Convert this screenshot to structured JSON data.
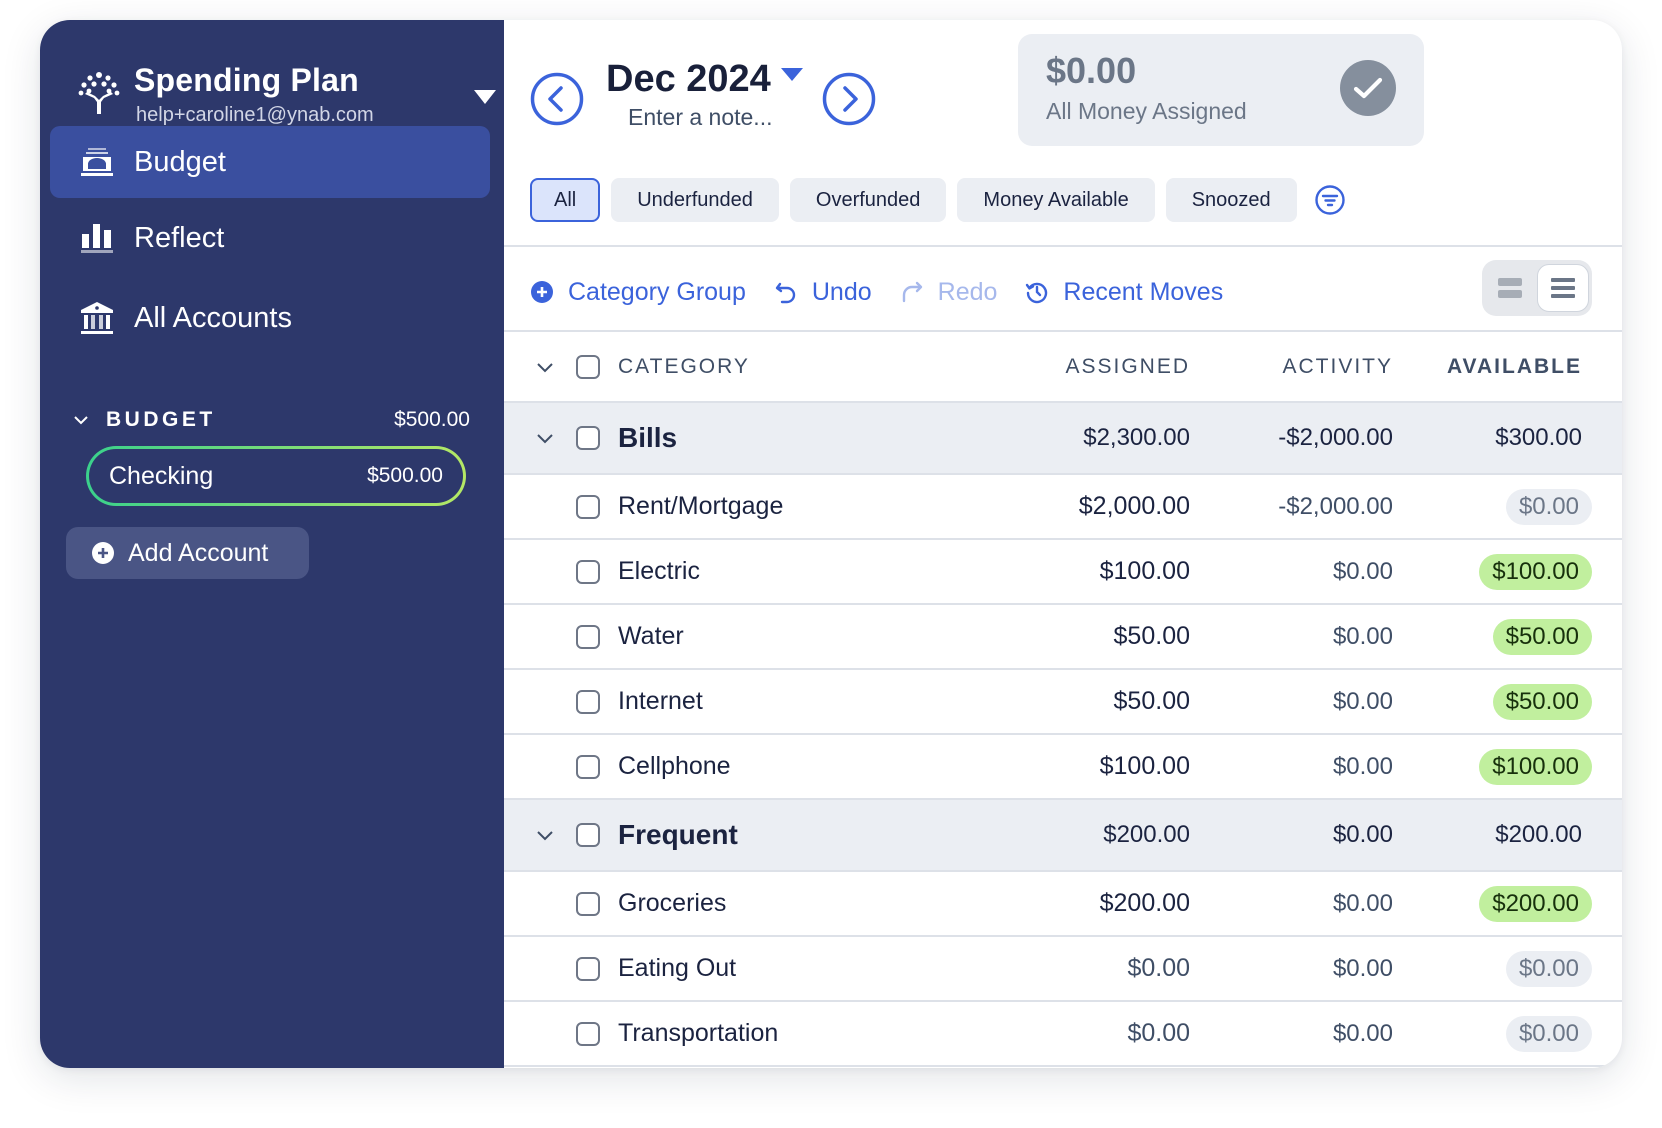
{
  "sidebar": {
    "plan_name": "Spending Plan",
    "email": "help+caroline1@ynab.com",
    "nav": [
      {
        "label": "Budget",
        "icon": "budget-icon",
        "active": true
      },
      {
        "label": "Reflect",
        "icon": "bar-chart-icon",
        "active": false
      },
      {
        "label": "All Accounts",
        "icon": "bank-icon",
        "active": false
      }
    ],
    "account_group": {
      "label": "BUDGET",
      "amount": "$500.00"
    },
    "accounts": [
      {
        "name": "Checking",
        "amount": "$500.00"
      }
    ],
    "add_account_label": "Add Account"
  },
  "header": {
    "month": "Dec 2024",
    "note_placeholder": "Enter a note...",
    "ready_to_assign": {
      "amount": "$0.00",
      "label": "All Money Assigned"
    }
  },
  "filters": [
    {
      "label": "All",
      "active": true
    },
    {
      "label": "Underfunded",
      "active": false
    },
    {
      "label": "Overfunded",
      "active": false
    },
    {
      "label": "Money Available",
      "active": false
    },
    {
      "label": "Snoozed",
      "active": false
    }
  ],
  "toolbar": {
    "category_group": "Category Group",
    "undo": "Undo",
    "redo": "Redo",
    "recent_moves": "Recent Moves"
  },
  "table": {
    "headers": {
      "category": "CATEGORY",
      "assigned": "ASSIGNED",
      "activity": "ACTIVITY",
      "available": "AVAILABLE"
    },
    "groups": [
      {
        "name": "Bills",
        "assigned": "$2,300.00",
        "activity": "-$2,000.00",
        "available": "$300.00",
        "categories": [
          {
            "name": "Rent/Mortgage",
            "assigned": "$2,000.00",
            "activity": "-$2,000.00",
            "available": "$0.00",
            "status": "zero"
          },
          {
            "name": "Electric",
            "assigned": "$100.00",
            "activity": "$0.00",
            "available": "$100.00",
            "status": "funded"
          },
          {
            "name": "Water",
            "assigned": "$50.00",
            "activity": "$0.00",
            "available": "$50.00",
            "status": "funded"
          },
          {
            "name": "Internet",
            "assigned": "$50.00",
            "activity": "$0.00",
            "available": "$50.00",
            "status": "funded"
          },
          {
            "name": "Cellphone",
            "assigned": "$100.00",
            "activity": "$0.00",
            "available": "$100.00",
            "status": "funded"
          }
        ]
      },
      {
        "name": "Frequent",
        "assigned": "$200.00",
        "activity": "$0.00",
        "available": "$200.00",
        "categories": [
          {
            "name": "Groceries",
            "assigned": "$200.00",
            "activity": "$0.00",
            "available": "$200.00",
            "status": "funded"
          },
          {
            "name": "Eating Out",
            "assigned": "$0.00",
            "activity": "$0.00",
            "available": "$0.00",
            "status": "zero"
          },
          {
            "name": "Transportation",
            "assigned": "$0.00",
            "activity": "$0.00",
            "available": "$0.00",
            "status": "zero"
          }
        ]
      }
    ]
  },
  "colors": {
    "sidebar_bg": "#2d386b",
    "nav_active_bg": "#3a4f9f",
    "accent_blue": "#3b63db",
    "funded_green": "#c1ef9e",
    "zero_gray": "#ebeef3",
    "group_row_bg": "#ebeef3"
  }
}
